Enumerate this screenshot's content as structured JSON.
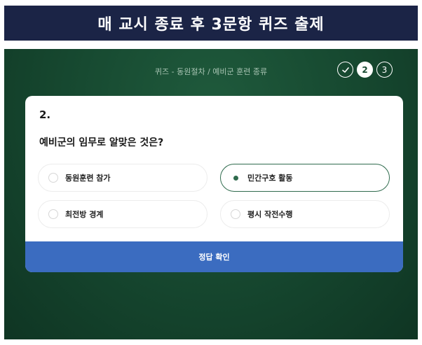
{
  "banner": {
    "title": "매 교시 종료 후 3문항 퀴즈 출제"
  },
  "quiz": {
    "breadcrumb": "퀴즈 - 동원절차 / 예비군 훈련 종류",
    "steps": [
      {
        "label": "✓",
        "state": "done"
      },
      {
        "label": "2",
        "state": "current"
      },
      {
        "label": "3",
        "state": "upcoming"
      }
    ],
    "question": {
      "number": "2.",
      "text": "예비군의 임무로 알맞은 것은?",
      "options": [
        {
          "label": "동원훈련 참가",
          "selected": false
        },
        {
          "label": "민간구호 활동",
          "selected": true
        },
        {
          "label": "최전방 경계",
          "selected": false
        },
        {
          "label": "평시 작전수행",
          "selected": false
        }
      ]
    },
    "submit_label": "정답 확인"
  },
  "colors": {
    "banner_bg": "#1b2446",
    "screen_bg": "#174a31",
    "accent_green": "#2f6b4d",
    "submit_blue": "#3b6cc0"
  }
}
